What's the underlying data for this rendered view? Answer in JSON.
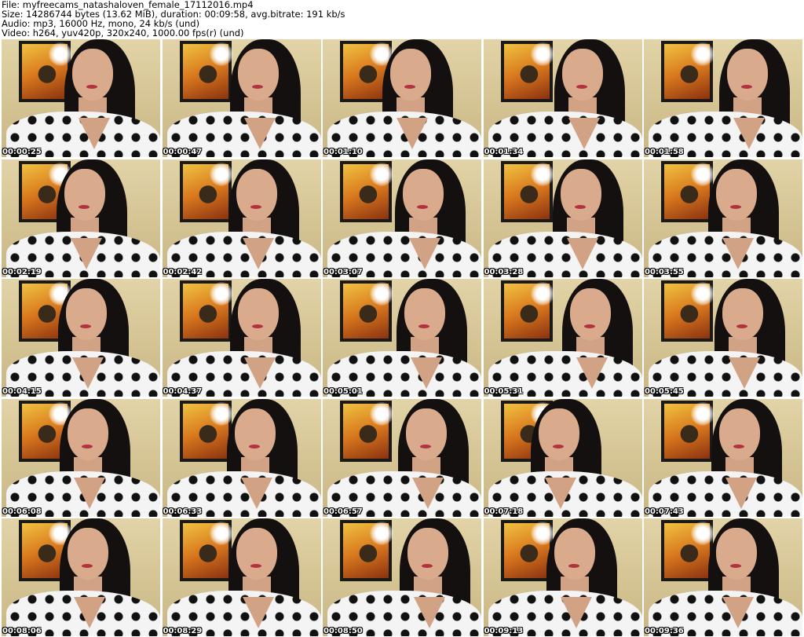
{
  "header": {
    "file_line": "File: myfreecams_natashaloven_female_17112016.mp4",
    "size_line": "Size: 14286744 bytes (13.62 MiB), duration: 00:09:58, avg.bitrate: 191 kb/s",
    "audio_line": "Audio: mp3, 16000 Hz, mono, 24 kb/s (und)",
    "video_line": "Video: h264, yuv420p, 320x240, 1000.00 fps(r) (und)"
  },
  "thumbnails": [
    {
      "timestamp": "00:00:25"
    },
    {
      "timestamp": "00:00:47"
    },
    {
      "timestamp": "00:01:10"
    },
    {
      "timestamp": "00:01:34"
    },
    {
      "timestamp": "00:01:58"
    },
    {
      "timestamp": "00:02:19"
    },
    {
      "timestamp": "00:02:42"
    },
    {
      "timestamp": "00:03:07"
    },
    {
      "timestamp": "00:03:28"
    },
    {
      "timestamp": "00:03:55"
    },
    {
      "timestamp": "00:04:15"
    },
    {
      "timestamp": "00:04:37"
    },
    {
      "timestamp": "00:05:01"
    },
    {
      "timestamp": "00:05:31"
    },
    {
      "timestamp": "00:05:45"
    },
    {
      "timestamp": "00:06:08"
    },
    {
      "timestamp": "00:06:33"
    },
    {
      "timestamp": "00:06:57"
    },
    {
      "timestamp": "00:07:18"
    },
    {
      "timestamp": "00:07:43"
    },
    {
      "timestamp": "00:08:06"
    },
    {
      "timestamp": "00:08:29"
    },
    {
      "timestamp": "00:08:50"
    },
    {
      "timestamp": "00:09:13"
    },
    {
      "timestamp": "00:09:36"
    }
  ],
  "colors": {
    "wall": "#d6c79e",
    "hair": "#141010",
    "shirt": "#f4f4f4",
    "dots": "#111111",
    "lips": "#b3323f"
  }
}
